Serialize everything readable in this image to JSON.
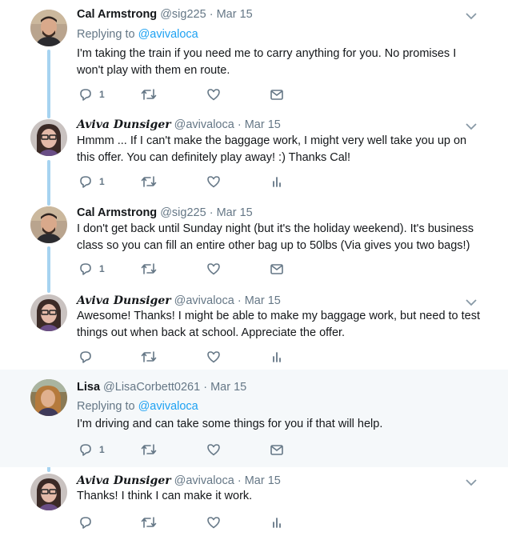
{
  "tweets": [
    {
      "name": "Cal Armstrong",
      "handle": "@sig225",
      "separator": "·",
      "date": "Mar 15",
      "replying_prefix": "Replying to",
      "replying_to": "@avivaloca",
      "text": "I'm taking the train if you need me to carry anything for you.  No promises I won't play with them en route.",
      "reply_count": "1",
      "icons": [
        "reply-icon",
        "retweet-icon",
        "like-icon",
        "message-icon"
      ]
    },
    {
      "name": "Aviva Dunsiger",
      "handle": "@avivaloca",
      "separator": "·",
      "date": "Mar 15",
      "text": "Hmmm ... If I can't make the baggage work, I might very well take you up on this offer. You can definitely play away! :) Thanks Cal!",
      "reply_count": "1",
      "icons": [
        "reply-icon",
        "retweet-icon",
        "like-icon",
        "analytics-icon"
      ]
    },
    {
      "name": "Cal Armstrong",
      "handle": "@sig225",
      "separator": "·",
      "date": "Mar 15",
      "text": "I don't get back until Sunday night (but it's the holiday weekend). It's business class so you can fill an entire other bag up to 50lbs (Via gives you two bags!)",
      "reply_count": "1",
      "icons": [
        "reply-icon",
        "retweet-icon",
        "like-icon",
        "message-icon"
      ]
    },
    {
      "name": "Aviva Dunsiger",
      "handle": "@avivaloca",
      "separator": "·",
      "date": "Mar 15",
      "text": "Awesome! Thanks! I might be able to make my baggage work, but need to test things out when back at school. Appreciate the offer.",
      "reply_count": "",
      "icons": [
        "reply-icon",
        "retweet-icon",
        "like-icon",
        "analytics-icon"
      ]
    },
    {
      "name": "Lisa",
      "handle": "@LisaCorbett0261",
      "separator": "·",
      "date": "Mar 15",
      "replying_prefix": "Replying to",
      "replying_to": "@avivaloca",
      "text": "I'm driving and can take some things for you if that will help.",
      "reply_count": "1",
      "icons": [
        "reply-icon",
        "retweet-icon",
        "like-icon",
        "message-icon"
      ]
    },
    {
      "name": "Aviva Dunsiger",
      "handle": "@avivaloca",
      "separator": "·",
      "date": "Mar 15",
      "text": "Thanks! I think I can make it work.",
      "reply_count": "",
      "icons": [
        "reply-icon",
        "retweet-icon",
        "like-icon",
        "analytics-icon"
      ]
    }
  ],
  "colors": {
    "text": "#14171a",
    "muted": "#657786",
    "link": "#1da1f2",
    "thread_line": "#a6d3f0",
    "highlight_bg": "#f5f8fa"
  }
}
